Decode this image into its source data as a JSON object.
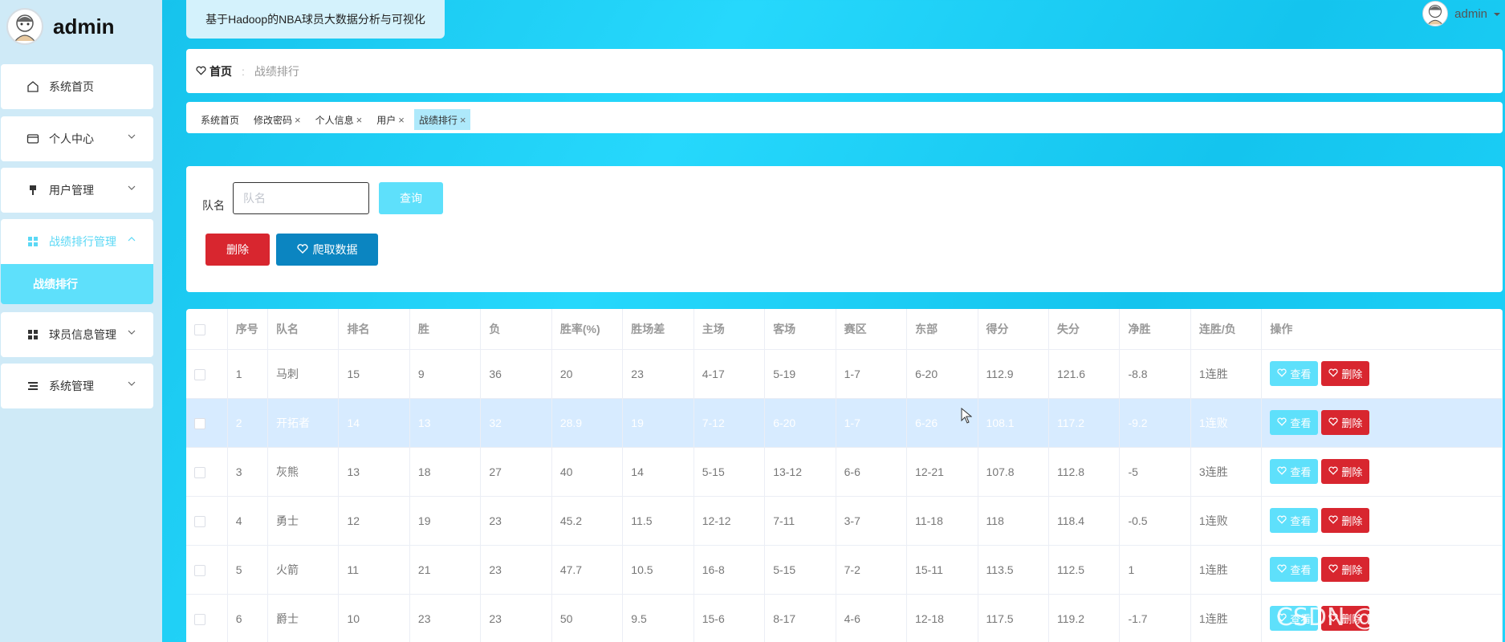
{
  "app": {
    "logo_text": "admin",
    "title": "基于Hadoop的NBA球员大数据分析与可视化"
  },
  "user": {
    "name": "admin"
  },
  "sidebar": {
    "items": [
      {
        "label": "系统首页",
        "icon": "home-icon"
      },
      {
        "label": "个人中心",
        "icon": "id-card-icon"
      },
      {
        "label": "用户管理",
        "icon": "pin-icon"
      },
      {
        "label": "战绩排行管理",
        "icon": "grid-icon"
      },
      {
        "label": "球员信息管理",
        "icon": "grid-icon"
      },
      {
        "label": "系统管理",
        "icon": "list-icon"
      }
    ],
    "sub_item": "战绩排行"
  },
  "breadcrumb": {
    "home": "首页",
    "separator": ":",
    "current": "战绩排行"
  },
  "tags": [
    {
      "label": "系统首页"
    },
    {
      "label": "修改密码"
    },
    {
      "label": "个人信息"
    },
    {
      "label": "用户"
    },
    {
      "label": "战绩排行"
    }
  ],
  "search": {
    "label": "队名",
    "placeholder": "队名",
    "query_button": "查询",
    "delete_button": "删除",
    "crawl_button": "爬取数据"
  },
  "table": {
    "columns": [
      "",
      "序号",
      "队名",
      "排名",
      "胜",
      "负",
      "胜率(%)",
      "胜场差",
      "主场",
      "客场",
      "赛区",
      "东部",
      "得分",
      "失分",
      "净胜",
      "连胜/负",
      "操作"
    ],
    "view_label": "查看",
    "delete_label": "删除",
    "rows": [
      [
        "1",
        "马刺",
        "15",
        "9",
        "36",
        "20",
        "23",
        "4-17",
        "5-19",
        "1-7",
        "6-20",
        "112.9",
        "121.6",
        "-8.8",
        "1连胜"
      ],
      [
        "2",
        "开拓者",
        "14",
        "13",
        "32",
        "28.9",
        "19",
        "7-12",
        "6-20",
        "1-7",
        "6-26",
        "108.1",
        "117.2",
        "-9.2",
        "1连败"
      ],
      [
        "3",
        "灰熊",
        "13",
        "18",
        "27",
        "40",
        "14",
        "5-15",
        "13-12",
        "6-6",
        "12-21",
        "107.8",
        "112.8",
        "-5",
        "3连胜"
      ],
      [
        "4",
        "勇士",
        "12",
        "19",
        "23",
        "45.2",
        "11.5",
        "12-12",
        "7-11",
        "3-7",
        "11-18",
        "118",
        "118.4",
        "-0.5",
        "1连败"
      ],
      [
        "5",
        "火箭",
        "11",
        "21",
        "23",
        "47.7",
        "10.5",
        "16-8",
        "5-15",
        "7-2",
        "15-11",
        "113.5",
        "112.5",
        "1",
        "1连胜"
      ],
      [
        "6",
        "爵士",
        "10",
        "23",
        "23",
        "50",
        "9.5",
        "15-6",
        "8-17",
        "4-6",
        "12-18",
        "117.5",
        "119.2",
        "-1.7",
        "1连胜"
      ]
    ]
  },
  "watermark": "CSDN @计算机学姐"
}
